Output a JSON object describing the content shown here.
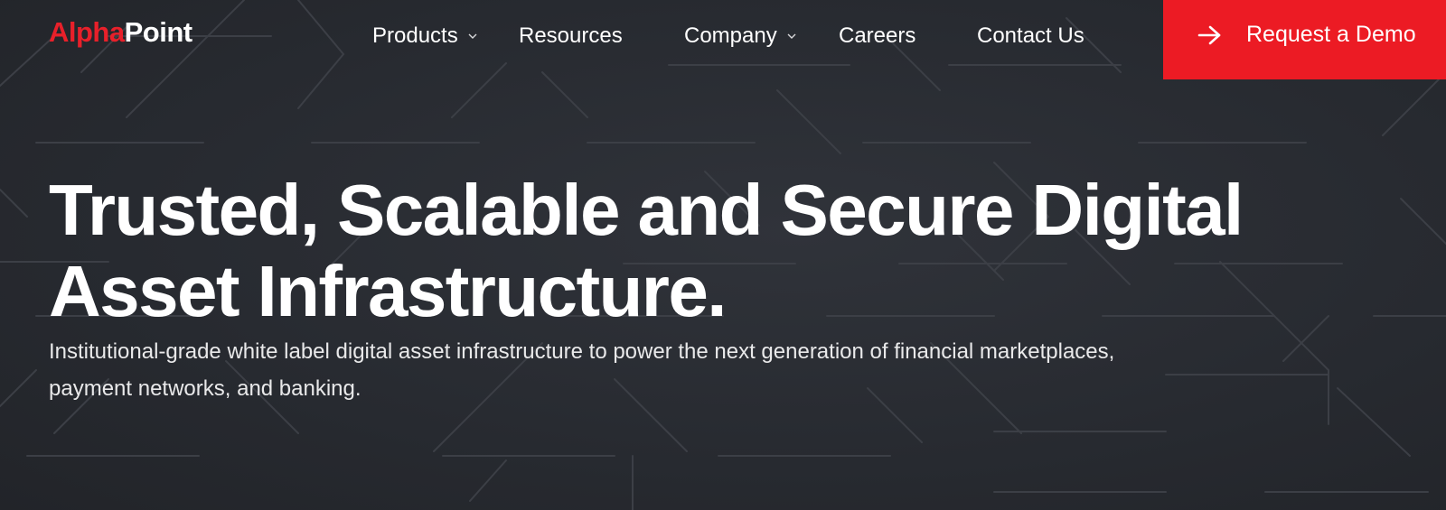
{
  "brand": {
    "logo_part1": "Alpha",
    "logo_part2": "Point",
    "accent_color": "#ec1b24"
  },
  "nav": {
    "items": [
      {
        "label": "Products",
        "has_dropdown": true
      },
      {
        "label": "Resources",
        "has_dropdown": false
      },
      {
        "label": "Company",
        "has_dropdown": true
      },
      {
        "label": "Careers",
        "has_dropdown": false
      },
      {
        "label": "Contact Us",
        "has_dropdown": false
      }
    ],
    "cta_label": "Request a Demo",
    "cta_icon": "arrow-right-icon"
  },
  "hero": {
    "title": "Trusted, Scalable and Secure Digital Asset Infrastructure.",
    "subtitle": "Institutional-grade white label digital asset infrastructure to power the next generation of financial marketplaces, payment networks, and banking."
  },
  "colors": {
    "background": "#2a2d33",
    "text": "#ffffff"
  }
}
